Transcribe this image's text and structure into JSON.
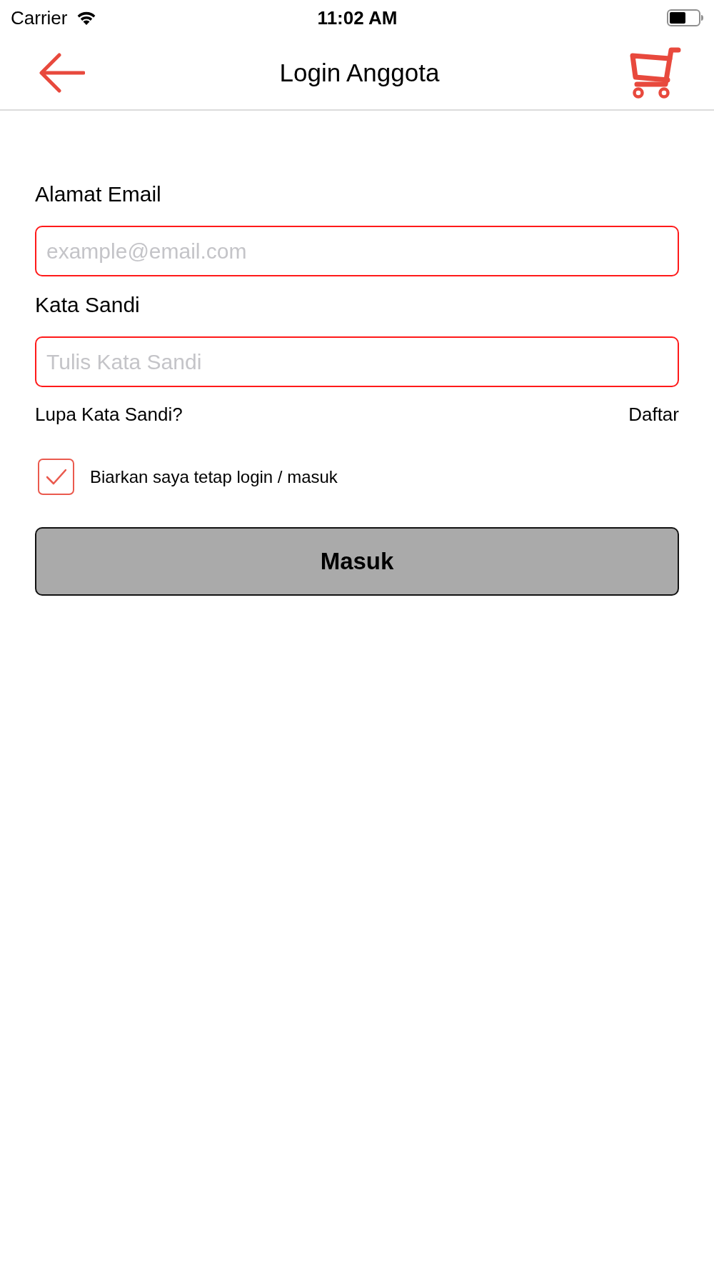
{
  "status_bar": {
    "carrier": "Carrier",
    "time": "11:02 AM"
  },
  "nav_bar": {
    "title": "Login Anggota"
  },
  "form": {
    "fields": [
      {
        "label": "Alamat Email",
        "placeholder": "example@email.com"
      },
      {
        "label": "Kata Sandi",
        "placeholder": "Tulis Kata Sandi"
      }
    ],
    "links": {
      "forgot": "Lupa Kata Sandi?",
      "register": "Daftar"
    },
    "remember": {
      "label": "Biarkan saya tetap login / masuk",
      "checked": true
    },
    "submit": "Masuk"
  }
}
